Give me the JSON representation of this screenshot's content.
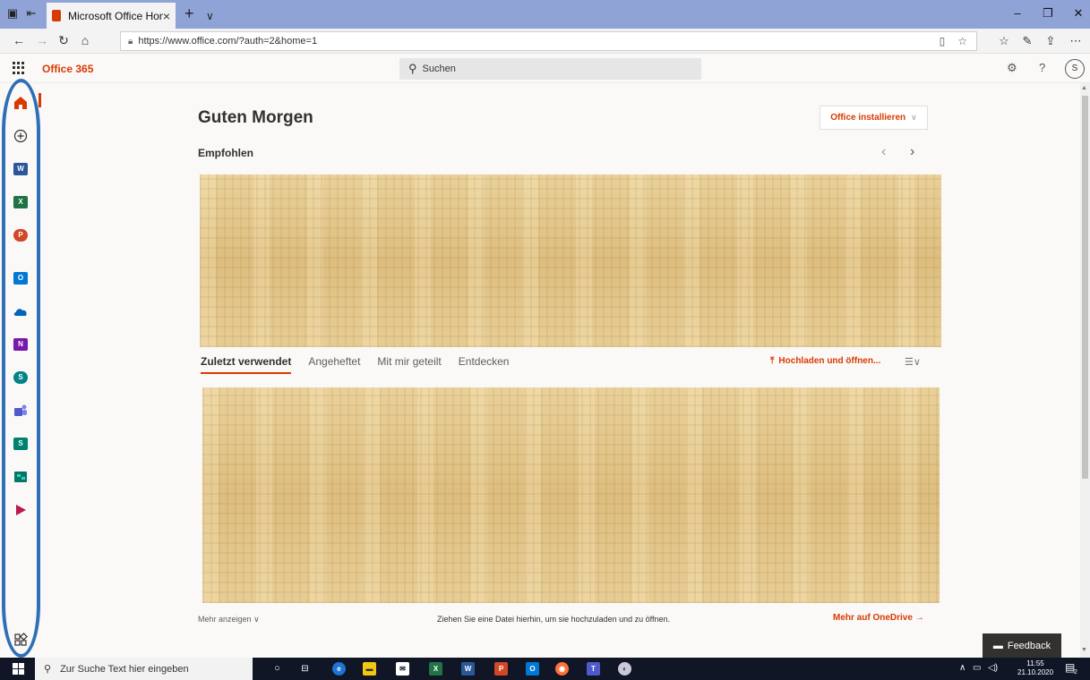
{
  "browser": {
    "tab_title": "Microsoft Office Home",
    "tab_close": "×",
    "new_tab": "+",
    "tab_menu": "∨",
    "url": "https://www.office.com/?auth=2&home=1",
    "window_minimize": "–",
    "window_restore": "❐",
    "window_close": "✕"
  },
  "header": {
    "brand": "Office 365",
    "search_placeholder": "Suchen",
    "settings_icon": "gear-icon",
    "help": "?",
    "avatar_initial": "S"
  },
  "rail": {
    "items": [
      {
        "name": "home",
        "icon": "home-icon",
        "color": "#d83b01"
      },
      {
        "name": "create",
        "icon": "plus-circle-icon",
        "color": "#323130"
      },
      {
        "name": "word",
        "icon": "word-icon",
        "label": "W",
        "color": "#2b579a"
      },
      {
        "name": "excel",
        "icon": "excel-icon",
        "label": "X",
        "color": "#217346"
      },
      {
        "name": "powerpoint",
        "icon": "powerpoint-icon",
        "label": "P",
        "color": "#d24726"
      },
      {
        "name": "outlook",
        "icon": "outlook-icon",
        "label": "O",
        "color": "#0078d4"
      },
      {
        "name": "onedrive",
        "icon": "onedrive-icon",
        "color": "#0364b8"
      },
      {
        "name": "onenote",
        "icon": "onenote-icon",
        "label": "N",
        "color": "#7719aa"
      },
      {
        "name": "sharepoint",
        "icon": "sharepoint-icon",
        "label": "S",
        "color": "#038387"
      },
      {
        "name": "teams",
        "icon": "teams-icon",
        "color": "#5059c9"
      },
      {
        "name": "sway",
        "icon": "sway-icon",
        "label": "S",
        "color": "#008272"
      },
      {
        "name": "planner",
        "icon": "planner-icon",
        "color": "#077568"
      },
      {
        "name": "stream",
        "icon": "stream-icon",
        "color": "#bc1948"
      },
      {
        "name": "all-apps",
        "icon": "all-apps-icon",
        "color": "#323130"
      }
    ]
  },
  "main": {
    "greeting": "Guten Morgen",
    "install_label": "Office installieren",
    "recommended_title": "Empfohlen",
    "file_tabs": [
      "Zuletzt verwendet",
      "Angeheftet",
      "Mit mir geteilt",
      "Entdecken"
    ],
    "upload_label": "Hochladen und öffnen...",
    "more_show": "Mehr anzeigen",
    "drop_hint": "Ziehen Sie eine Datei hierhin, um sie hochzuladen und zu öffnen.",
    "more_onedrive": "Mehr auf OneDrive",
    "feedback": "Feedback"
  },
  "taskbar": {
    "search_placeholder": "Zur Suche Text hier eingeben",
    "time": "11:55",
    "date": "21.10.2020",
    "notification_count": "2"
  }
}
